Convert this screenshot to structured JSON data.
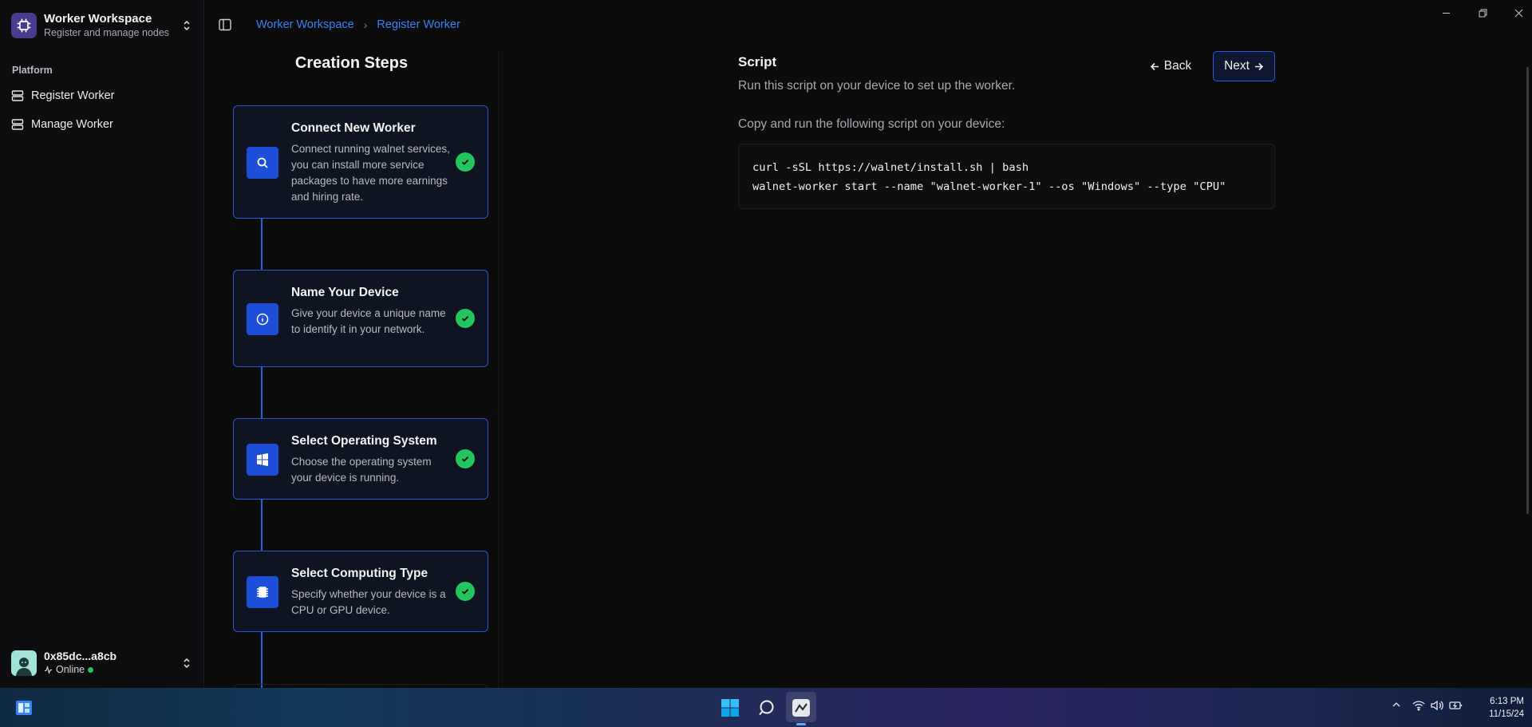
{
  "workspace": {
    "title": "Worker Workspace",
    "subtitle": "Register and manage nodes"
  },
  "sidebar": {
    "group_label": "Platform",
    "items": [
      {
        "label": "Register Worker",
        "icon": "server-icon"
      },
      {
        "label": "Manage Worker",
        "icon": "server-icon"
      }
    ]
  },
  "user": {
    "address": "0x85dc...a8cb",
    "status": "Online"
  },
  "breadcrumb": {
    "root": "Worker Workspace",
    "current": "Register Worker"
  },
  "steps": {
    "title": "Creation Steps",
    "items": [
      {
        "title": "Connect New Worker",
        "description": "Connect running walnet services, you can install more service packages to have more earnings and hiring rate.",
        "icon": "search-icon",
        "completed": true
      },
      {
        "title": "Name Your Device",
        "description": "Give your device a unique name to identify it in your network.",
        "icon": "info-icon",
        "completed": true
      },
      {
        "title": "Select Operating System",
        "description": "Choose the operating system your device is running.",
        "icon": "windows-icon",
        "completed": true
      },
      {
        "title": "Select Computing Type",
        "description": "Specify whether your device is a CPU or GPU device.",
        "icon": "chip-icon",
        "completed": true
      }
    ]
  },
  "content": {
    "title": "Script",
    "subtitle": "Run this script on your device to set up the worker.",
    "instruction": "Copy and run the following script on your device:",
    "code": "curl -sSL https://walnet/install.sh | bash\nwalnet-worker start --name \"walnet-worker-1\" --os \"Windows\" --type \"CPU\"",
    "back_label": "Back",
    "next_label": "Next"
  },
  "taskbar": {
    "time": "6:13 PM",
    "date": "11/15/24"
  },
  "colors": {
    "accent": "#2563eb",
    "success": "#22c55e",
    "background": "#0b0b0c",
    "link": "#3b82f6"
  }
}
